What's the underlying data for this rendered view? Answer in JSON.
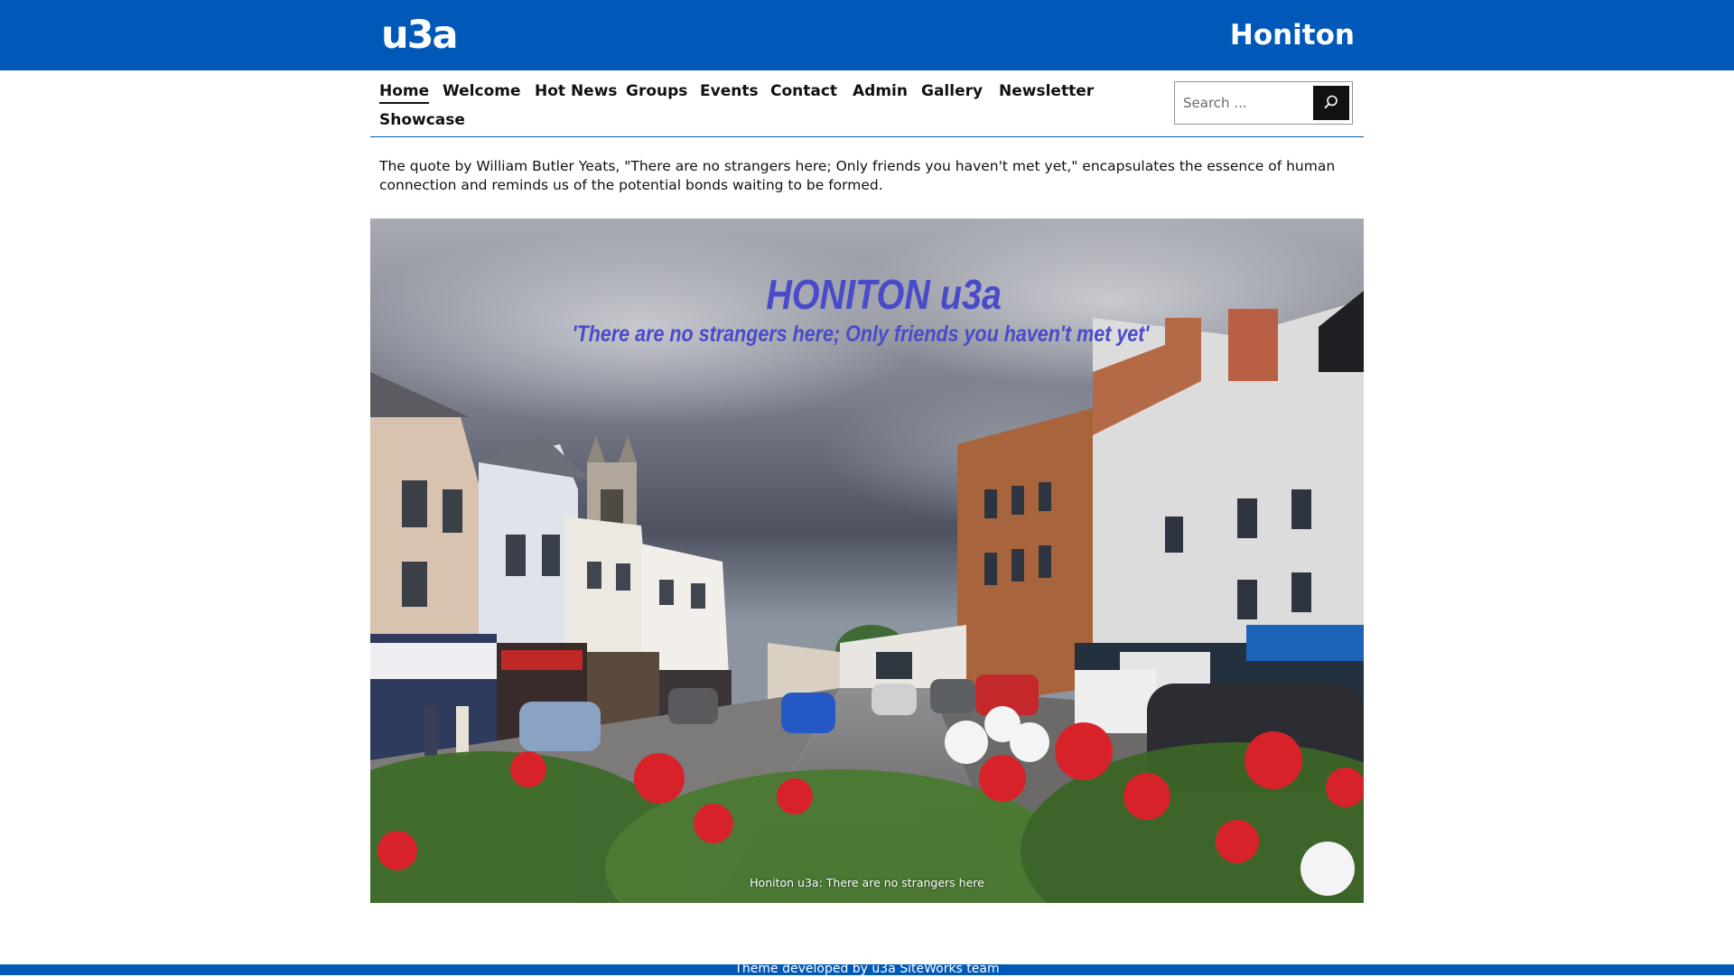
{
  "header": {
    "logo_text": "u3a",
    "site_title": "Honiton"
  },
  "nav": {
    "items": [
      {
        "label": "Home",
        "active": true
      },
      {
        "label": "Welcome"
      },
      {
        "label": "Hot News"
      },
      {
        "label": "Groups"
      },
      {
        "label": "Events"
      },
      {
        "label": "Contact"
      },
      {
        "label": "Admin"
      },
      {
        "label": "Gallery"
      },
      {
        "label": "Newsletter"
      },
      {
        "label": "Showcase"
      }
    ]
  },
  "search": {
    "placeholder": "Search ...",
    "button_icon": "search-icon"
  },
  "intro": {
    "text": "The quote by William Butler Yeats, \"There are no strangers here; Only friends you haven't met yet,\" encapsulates the essence of human connection and reminds us of the potential bonds waiting to be formed."
  },
  "banner": {
    "heading": "HONITON u3a",
    "quote": "'There are no strangers here; Only friends you haven't met yet'",
    "caption": "Honiton u3a: There are no strangers here"
  },
  "footer": {
    "text": "Theme developed by u3a SiteWorks team"
  },
  "colors": {
    "brand_blue": "#0059b8",
    "banner_text": "#4a4bc8",
    "search_button": "#111111"
  }
}
